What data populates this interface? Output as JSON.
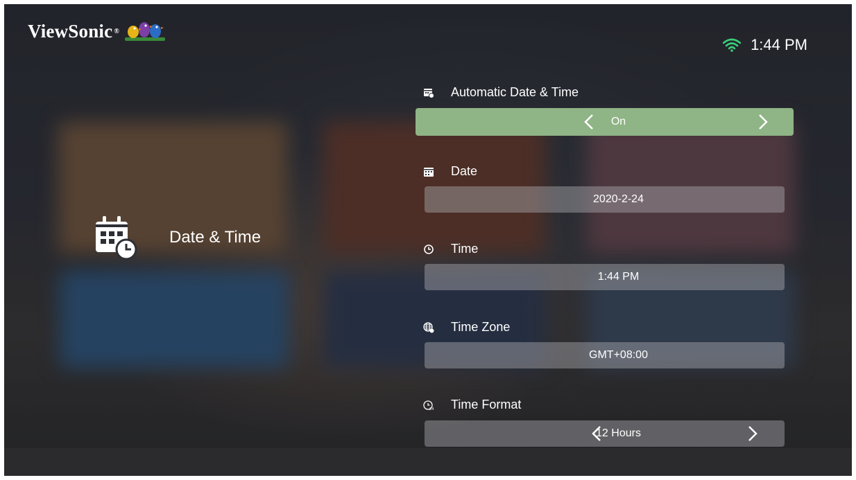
{
  "brand": {
    "logo_text": "ViewSonic",
    "reg_mark": "®"
  },
  "status_bar": {
    "wifi_icon": "wifi-icon",
    "time": "1:44 PM"
  },
  "category": {
    "icon": "calendar-clock-icon",
    "title": "Date & Time"
  },
  "settings": [
    {
      "icon": "calendar-clock-small-icon",
      "label": "Automatic Date & Time",
      "value": "On",
      "selected": true,
      "has_arrows": true
    },
    {
      "icon": "calendar-icon",
      "label": "Date",
      "value": "2020-2-24",
      "selected": false,
      "has_arrows": false
    },
    {
      "icon": "clock-icon",
      "label": "Time",
      "value": "1:44 PM",
      "selected": false,
      "has_arrows": false
    },
    {
      "icon": "globe-icon",
      "label": "Time Zone",
      "value": "GMT+08:00",
      "selected": false,
      "has_arrows": false
    },
    {
      "icon": "clock-24-icon",
      "label": "Time Format",
      "value": "12 Hours",
      "selected": false,
      "has_arrows": true
    }
  ],
  "colors": {
    "selected_bar": "#8fb486",
    "bar": "#9a9aa0",
    "text": "#ffffff"
  }
}
